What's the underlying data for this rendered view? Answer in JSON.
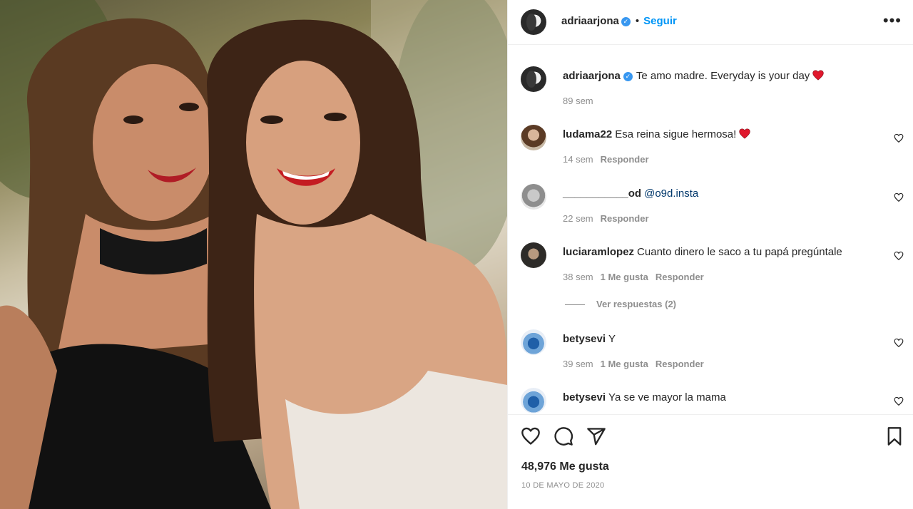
{
  "post": {
    "owner": "adriaarjona",
    "follow_label": "Seguir",
    "separator": "•",
    "more_icon": "more-options-icon",
    "photo_alt": "photo"
  },
  "caption": {
    "user": "adriaarjona",
    "text": "Te amo madre. Everyday is your day",
    "time": "89 sem",
    "emoji": "red-heart"
  },
  "comments": [
    {
      "user": "ludama22",
      "text": "Esa reina sigue hermosa!",
      "emoji": "red-heart",
      "time": "14 sem",
      "likes": "",
      "reply": "Responder"
    },
    {
      "user": "___________od",
      "text": "",
      "mention": "@o9d.insta",
      "time": "22 sem",
      "likes": "",
      "reply": "Responder"
    },
    {
      "user": "luciaramlopez",
      "text": "Cuanto dinero le saco a tu papá pregúntale",
      "time": "38 sem",
      "likes": "1 Me gusta",
      "reply": "Responder"
    },
    {
      "user": "betysevi",
      "text": "Y",
      "time": "39 sem",
      "likes": "1 Me gusta",
      "reply": "Responder"
    },
    {
      "user": "betysevi",
      "text": "Ya se ve mayor la mama",
      "time": "",
      "likes": "",
      "reply": ""
    }
  ],
  "view_replies": "Ver respuestas (2)",
  "footer": {
    "likes": "48,976 Me gusta",
    "date": "10 DE MAYO DE 2020"
  },
  "colors": {
    "accent": "#0095f6",
    "verified": "#3897f0",
    "muted": "#8e8e8e",
    "heart": "#ed4956"
  }
}
